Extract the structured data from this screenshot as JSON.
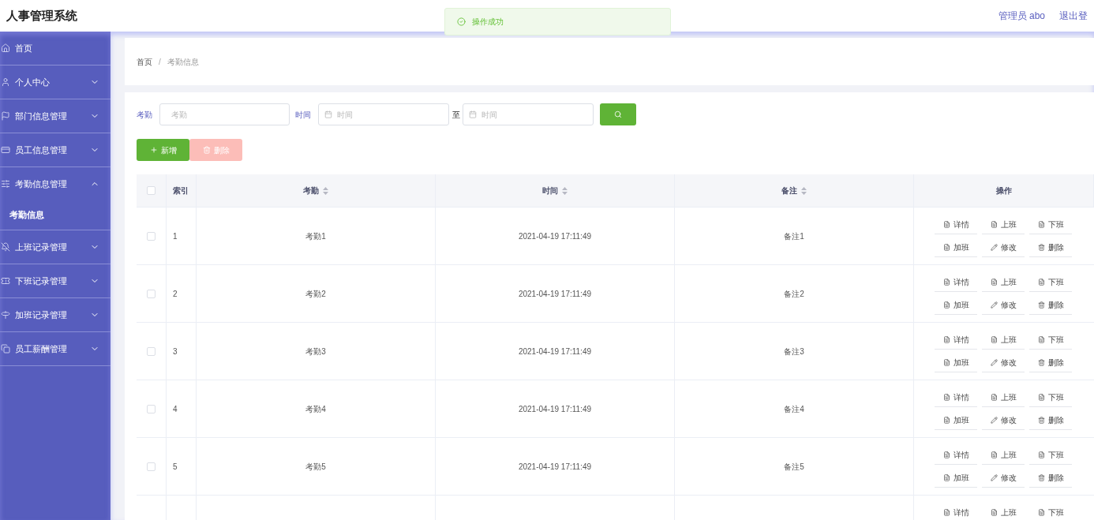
{
  "header": {
    "title": "人事管理系统",
    "user": "管理员 abo",
    "logout": "退出登"
  },
  "toast": {
    "message": "操作成功"
  },
  "sidebar": {
    "items": [
      {
        "label": "首页"
      },
      {
        "label": "个人中心",
        "expanded": false
      },
      {
        "label": "部门信息管理",
        "expanded": false
      },
      {
        "label": "员工信息管理",
        "expanded": false
      },
      {
        "label": "考勤信息管理",
        "expanded": true,
        "children": [
          {
            "label": "考勤信息"
          }
        ]
      },
      {
        "label": "上班记录管理",
        "expanded": false
      },
      {
        "label": "下班记录管理",
        "expanded": false
      },
      {
        "label": "加班记录管理",
        "expanded": false
      },
      {
        "label": "员工薪酬管理",
        "expanded": false
      }
    ]
  },
  "breadcrumb": {
    "items": [
      "首页",
      "考勤信息"
    ],
    "separator": "/"
  },
  "search": {
    "fields": [
      {
        "label": "考勤",
        "placeholder": "考勤",
        "kind": "text"
      },
      {
        "label": "时间",
        "placeholder": "时间",
        "kind": "date"
      },
      {
        "label": "至",
        "placeholder": "时间",
        "kind": "date"
      }
    ]
  },
  "buttons": [
    {
      "label": "新增",
      "kind": "add",
      "disabled": false
    },
    {
      "label": "删除",
      "kind": "delete",
      "disabled": true
    }
  ],
  "table": {
    "header_checked": false,
    "columns": [
      {
        "label": "索引",
        "sortable": false
      },
      {
        "label": "考勤",
        "sortable": true
      },
      {
        "label": "时间",
        "sortable": true
      },
      {
        "label": "备注",
        "sortable": true
      },
      {
        "label": "操作",
        "sortable": false
      }
    ],
    "rows": [
      {
        "checked": false,
        "cells": [
          "1",
          "考勤1",
          "2021-04-19 17:11:49",
          "备注1"
        ],
        "actions": [
          {
            "label": "详情",
            "kind": "doc"
          },
          {
            "label": "上班",
            "kind": "doc"
          },
          {
            "label": "下班",
            "kind": "doc"
          },
          {
            "label": "加班",
            "kind": "doc"
          },
          {
            "label": "修改",
            "kind": "edit"
          },
          {
            "label": "删除",
            "kind": "delete"
          }
        ]
      },
      {
        "checked": false,
        "cells": [
          "2",
          "考勤2",
          "2021-04-19 17:11:49",
          "备注2"
        ],
        "actions": [
          {
            "label": "详情",
            "kind": "doc"
          },
          {
            "label": "上班",
            "kind": "doc"
          },
          {
            "label": "下班",
            "kind": "doc"
          },
          {
            "label": "加班",
            "kind": "doc"
          },
          {
            "label": "修改",
            "kind": "edit"
          },
          {
            "label": "删除",
            "kind": "delete"
          }
        ]
      },
      {
        "checked": false,
        "cells": [
          "3",
          "考勤3",
          "2021-04-19 17:11:49",
          "备注3"
        ],
        "actions": [
          {
            "label": "详情",
            "kind": "doc"
          },
          {
            "label": "上班",
            "kind": "doc"
          },
          {
            "label": "下班",
            "kind": "doc"
          },
          {
            "label": "加班",
            "kind": "doc"
          },
          {
            "label": "修改",
            "kind": "edit"
          },
          {
            "label": "删除",
            "kind": "delete"
          }
        ]
      },
      {
        "checked": false,
        "cells": [
          "4",
          "考勤4",
          "2021-04-19 17:11:49",
          "备注4"
        ],
        "actions": [
          {
            "label": "详情",
            "kind": "doc"
          },
          {
            "label": "上班",
            "kind": "doc"
          },
          {
            "label": "下班",
            "kind": "doc"
          },
          {
            "label": "加班",
            "kind": "doc"
          },
          {
            "label": "修改",
            "kind": "edit"
          },
          {
            "label": "删除",
            "kind": "delete"
          }
        ]
      },
      {
        "checked": false,
        "cells": [
          "5",
          "考勤5",
          "2021-04-19 17:11:49",
          "备注5"
        ],
        "actions": [
          {
            "label": "详情",
            "kind": "doc"
          },
          {
            "label": "上班",
            "kind": "doc"
          },
          {
            "label": "下班",
            "kind": "doc"
          },
          {
            "label": "加班",
            "kind": "doc"
          },
          {
            "label": "修改",
            "kind": "edit"
          },
          {
            "label": "删除",
            "kind": "delete"
          }
        ]
      },
      {
        "cells": [],
        "actions": [
          {
            "label": "详情",
            "kind": "doc"
          },
          {
            "label": "上班",
            "kind": "doc"
          },
          {
            "label": "下班",
            "kind": "doc"
          }
        ]
      }
    ]
  }
}
